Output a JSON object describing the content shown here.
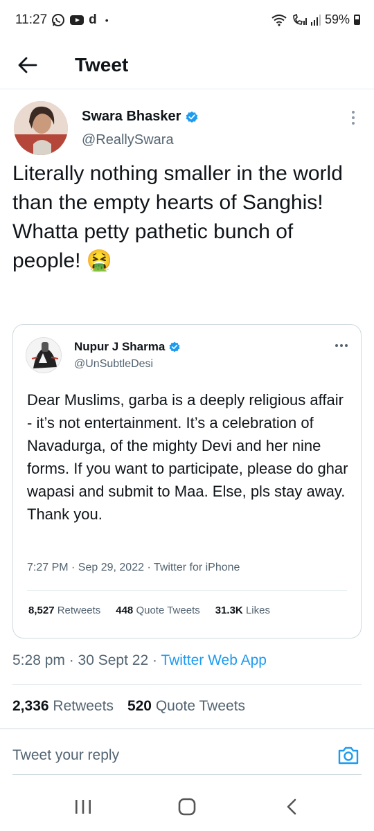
{
  "status_bar": {
    "time": "11:27",
    "d_label": "d",
    "dot": "•",
    "battery": "59%"
  },
  "header": {
    "title": "Tweet"
  },
  "tweet": {
    "author_name": "Swara Bhasker",
    "author_handle": "@ReallySwara",
    "text_line1": "Literally nothing smaller in the world than the empty hearts of Sanghis!",
    "text_line2": "Whatta petty pathetic bunch of people! 🤮",
    "timestamp": "5:28 pm · 30 Sept 22 · ",
    "source": "Twitter Web App",
    "retweets_count": "2,336",
    "retweets_label": "Retweets",
    "quote_count": "520",
    "quote_label": "Quote Tweets"
  },
  "quoted_tweet": {
    "author_name": "Nupur J Sharma",
    "author_handle": "@UnSubtleDesi",
    "text": "Dear Muslims, garba is a deeply religious affair - it’s not entertainment. It’s a celebration of Navadurga, of the mighty Devi and her nine forms. If you want to participate, please do ghar wapasi and submit to Maa. Else, pls stay away. Thank you.",
    "meta": "7:27 PM · Sep 29, 2022 · Twitter for iPhone",
    "retweets_count": "8,527",
    "retweets_label": "Retweets",
    "quote_count": "448",
    "quote_label": "Quote Tweets",
    "likes_count": "31.3K",
    "likes_label": "Likes"
  },
  "reply": {
    "placeholder": "Tweet your reply"
  },
  "icons": {
    "back": "arrow-left-icon",
    "verified": "verified-badge-icon",
    "more": "more-icon",
    "camera": "camera-icon",
    "nav_recents": "recent-apps-icon",
    "nav_home": "home-icon",
    "nav_back": "chevron-left-icon"
  },
  "colors": {
    "accent": "#1d9bf0",
    "text_primary": "#0f1419",
    "text_secondary": "#536471"
  }
}
